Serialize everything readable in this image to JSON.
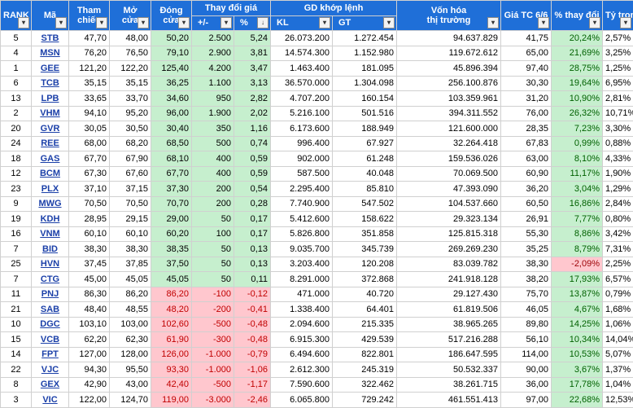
{
  "headers": {
    "rank": "RANK",
    "ma": "Mã",
    "tham_chieu": [
      "Tham",
      "chiếu"
    ],
    "mo_cua": [
      "Mở",
      "cửa"
    ],
    "dong_cua": [
      "Đóng",
      "cửa"
    ],
    "thay_doi": "Thay đổi giá",
    "thay_doi_abs": "+/-",
    "thay_doi_pct": "%",
    "gd": "GD khớp lệnh",
    "kl": "KL",
    "gt": "GT",
    "von_hoa": [
      "Vốn hóa",
      "thị trường"
    ],
    "gia_tc": "Giá TC 6/6",
    "pct_thay_doi": "% thay đổi",
    "ty_trong": "Tỷ trọng"
  },
  "filter_icon": "▾",
  "sort_icon": "↓",
  "colors": {
    "header_bg": "#1f6fd8",
    "green_fill": "#c6efce",
    "red_fill": "#ffc7ce",
    "neg_text": "#c00000"
  },
  "rows": [
    {
      "rank": "5",
      "ma": "STB",
      "tc": "47,70",
      "mo": "48,00",
      "dong": "50,20",
      "abs": "2.500",
      "pct": "5,24",
      "kl": "26.073.200",
      "gt": "1.272.454",
      "vh": "94.637.829",
      "gia": "41,75",
      "pct2": "20,24%",
      "tt": "2,57%",
      "dir": "up",
      "pct2sign": "pos"
    },
    {
      "rank": "4",
      "ma": "MSN",
      "tc": "76,20",
      "mo": "76,50",
      "dong": "79,10",
      "abs": "2.900",
      "pct": "3,81",
      "kl": "14.574.300",
      "gt": "1.152.980",
      "vh": "119.672.612",
      "gia": "65,00",
      "pct2": "21,69%",
      "tt": "3,25%",
      "dir": "up",
      "pct2sign": "pos"
    },
    {
      "rank": "1",
      "ma": "GEE",
      "tc": "121,20",
      "mo": "122,20",
      "dong": "125,40",
      "abs": "4.200",
      "pct": "3,47",
      "kl": "1.463.400",
      "gt": "181.095",
      "vh": "45.896.394",
      "gia": "97,40",
      "pct2": "28,75%",
      "tt": "1,25%",
      "dir": "up",
      "pct2sign": "pos"
    },
    {
      "rank": "6",
      "ma": "TCB",
      "tc": "35,15",
      "mo": "35,15",
      "dong": "36,25",
      "abs": "1.100",
      "pct": "3,13",
      "kl": "36.570.000",
      "gt": "1.304.098",
      "vh": "256.100.876",
      "gia": "30,30",
      "pct2": "19,64%",
      "tt": "6,95%",
      "dir": "up",
      "pct2sign": "pos"
    },
    {
      "rank": "13",
      "ma": "LPB",
      "tc": "33,65",
      "mo": "33,70",
      "dong": "34,60",
      "abs": "950",
      "pct": "2,82",
      "kl": "4.707.200",
      "gt": "160.154",
      "vh": "103.359.961",
      "gia": "31,20",
      "pct2": "10,90%",
      "tt": "2,81%",
      "dir": "up",
      "pct2sign": "pos"
    },
    {
      "rank": "2",
      "ma": "VHM",
      "tc": "94,10",
      "mo": "95,20",
      "dong": "96,00",
      "abs": "1.900",
      "pct": "2,02",
      "kl": "5.216.100",
      "gt": "501.516",
      "vh": "394.311.552",
      "gia": "76,00",
      "pct2": "26,32%",
      "tt": "10,71%",
      "dir": "up",
      "pct2sign": "pos"
    },
    {
      "rank": "20",
      "ma": "GVR",
      "tc": "30,05",
      "mo": "30,50",
      "dong": "30,40",
      "abs": "350",
      "pct": "1,16",
      "kl": "6.173.600",
      "gt": "188.949",
      "vh": "121.600.000",
      "gia": "28,35",
      "pct2": "7,23%",
      "tt": "3,30%",
      "dir": "up",
      "pct2sign": "pos"
    },
    {
      "rank": "24",
      "ma": "REE",
      "tc": "68,00",
      "mo": "68,20",
      "dong": "68,50",
      "abs": "500",
      "pct": "0,74",
      "kl": "996.400",
      "gt": "67.927",
      "vh": "32.264.418",
      "gia": "67,83",
      "pct2": "0,99%",
      "tt": "0,88%",
      "dir": "up",
      "pct2sign": "pos"
    },
    {
      "rank": "18",
      "ma": "GAS",
      "tc": "67,70",
      "mo": "67,90",
      "dong": "68,10",
      "abs": "400",
      "pct": "0,59",
      "kl": "902.000",
      "gt": "61.248",
      "vh": "159.536.026",
      "gia": "63,00",
      "pct2": "8,10%",
      "tt": "4,33%",
      "dir": "up",
      "pct2sign": "pos"
    },
    {
      "rank": "12",
      "ma": "BCM",
      "tc": "67,30",
      "mo": "67,60",
      "dong": "67,70",
      "abs": "400",
      "pct": "0,59",
      "kl": "587.500",
      "gt": "40.048",
      "vh": "70.069.500",
      "gia": "60,90",
      "pct2": "11,17%",
      "tt": "1,90%",
      "dir": "up",
      "pct2sign": "pos"
    },
    {
      "rank": "23",
      "ma": "PLX",
      "tc": "37,10",
      "mo": "37,15",
      "dong": "37,30",
      "abs": "200",
      "pct": "0,54",
      "kl": "2.295.400",
      "gt": "85.810",
      "vh": "47.393.090",
      "gia": "36,20",
      "pct2": "3,04%",
      "tt": "1,29%",
      "dir": "up",
      "pct2sign": "pos"
    },
    {
      "rank": "9",
      "ma": "MWG",
      "tc": "70,50",
      "mo": "70,50",
      "dong": "70,70",
      "abs": "200",
      "pct": "0,28",
      "kl": "7.740.900",
      "gt": "547.502",
      "vh": "104.537.660",
      "gia": "60,50",
      "pct2": "16,86%",
      "tt": "2,84%",
      "dir": "up",
      "pct2sign": "pos"
    },
    {
      "rank": "19",
      "ma": "KDH",
      "tc": "28,95",
      "mo": "29,15",
      "dong": "29,00",
      "abs": "50",
      "pct": "0,17",
      "kl": "5.412.600",
      "gt": "158.622",
      "vh": "29.323.134",
      "gia": "26,91",
      "pct2": "7,77%",
      "tt": "0,80%",
      "dir": "up",
      "pct2sign": "pos"
    },
    {
      "rank": "16",
      "ma": "VNM",
      "tc": "60,10",
      "mo": "60,10",
      "dong": "60,20",
      "abs": "100",
      "pct": "0,17",
      "kl": "5.826.800",
      "gt": "351.858",
      "vh": "125.815.318",
      "gia": "55,30",
      "pct2": "8,86%",
      "tt": "3,42%",
      "dir": "up",
      "pct2sign": "pos"
    },
    {
      "rank": "7",
      "ma": "BID",
      "tc": "38,30",
      "mo": "38,30",
      "dong": "38,35",
      "abs": "50",
      "pct": "0,13",
      "kl": "9.035.700",
      "gt": "345.739",
      "vh": "269.269.230",
      "gia": "35,25",
      "pct2": "8,79%",
      "tt": "7,31%",
      "dir": "up",
      "pct2sign": "pos"
    },
    {
      "rank": "25",
      "ma": "HVN",
      "tc": "37,45",
      "mo": "37,85",
      "dong": "37,50",
      "abs": "50",
      "pct": "0,13",
      "kl": "3.203.400",
      "gt": "120.208",
      "vh": "83.039.782",
      "gia": "38,30",
      "pct2": "-2,09%",
      "tt": "2,25%",
      "dir": "up",
      "pct2sign": "neg"
    },
    {
      "rank": "7",
      "ma": "CTG",
      "tc": "45,00",
      "mo": "45,05",
      "dong": "45,05",
      "abs": "50",
      "pct": "0,11",
      "kl": "8.291.000",
      "gt": "372.868",
      "vh": "241.918.128",
      "gia": "38,20",
      "pct2": "17,93%",
      "tt": "6,57%",
      "dir": "up",
      "pct2sign": "pos"
    },
    {
      "rank": "11",
      "ma": "PNJ",
      "tc": "86,30",
      "mo": "86,20",
      "dong": "86,20",
      "abs": "-100",
      "pct": "-0,12",
      "kl": "471.000",
      "gt": "40.720",
      "vh": "29.127.430",
      "gia": "75,70",
      "pct2": "13,87%",
      "tt": "0,79%",
      "dir": "down",
      "pct2sign": "pos"
    },
    {
      "rank": "21",
      "ma": "SAB",
      "tc": "48,40",
      "mo": "48,55",
      "dong": "48,20",
      "abs": "-200",
      "pct": "-0,41",
      "kl": "1.338.400",
      "gt": "64.401",
      "vh": "61.819.506",
      "gia": "46,05",
      "pct2": "4,67%",
      "tt": "1,68%",
      "dir": "down",
      "pct2sign": "pos"
    },
    {
      "rank": "10",
      "ma": "DGC",
      "tc": "103,10",
      "mo": "103,00",
      "dong": "102,60",
      "abs": "-500",
      "pct": "-0,48",
      "kl": "2.094.600",
      "gt": "215.335",
      "vh": "38.965.265",
      "gia": "89,80",
      "pct2": "14,25%",
      "tt": "1,06%",
      "dir": "down",
      "pct2sign": "pos"
    },
    {
      "rank": "15",
      "ma": "VCB",
      "tc": "62,20",
      "mo": "62,30",
      "dong": "61,90",
      "abs": "-300",
      "pct": "-0,48",
      "kl": "6.915.300",
      "gt": "429.539",
      "vh": "517.216.288",
      "gia": "56,10",
      "pct2": "10,34%",
      "tt": "14,04%",
      "dir": "down",
      "pct2sign": "pos"
    },
    {
      "rank": "14",
      "ma": "FPT",
      "tc": "127,00",
      "mo": "128,00",
      "dong": "126,00",
      "abs": "-1.000",
      "pct": "-0,79",
      "kl": "6.494.600",
      "gt": "822.801",
      "vh": "186.647.595",
      "gia": "114,00",
      "pct2": "10,53%",
      "tt": "5,07%",
      "dir": "down",
      "pct2sign": "pos"
    },
    {
      "rank": "22",
      "ma": "VJC",
      "tc": "94,30",
      "mo": "95,50",
      "dong": "93,30",
      "abs": "-1.000",
      "pct": "-1,06",
      "kl": "2.612.300",
      "gt": "245.319",
      "vh": "50.532.337",
      "gia": "90,00",
      "pct2": "3,67%",
      "tt": "1,37%",
      "dir": "down",
      "pct2sign": "pos"
    },
    {
      "rank": "8",
      "ma": "GEX",
      "tc": "42,90",
      "mo": "43,00",
      "dong": "42,40",
      "abs": "-500",
      "pct": "-1,17",
      "kl": "7.590.600",
      "gt": "322.462",
      "vh": "38.261.715",
      "gia": "36,00",
      "pct2": "17,78%",
      "tt": "1,04%",
      "dir": "down",
      "pct2sign": "pos"
    },
    {
      "rank": "3",
      "ma": "VIC",
      "tc": "122,00",
      "mo": "124,70",
      "dong": "119,00",
      "abs": "-3.000",
      "pct": "-2,46",
      "kl": "6.065.800",
      "gt": "729.242",
      "vh": "461.551.413",
      "gia": "97,00",
      "pct2": "22,68%",
      "tt": "12,53%",
      "dir": "down",
      "pct2sign": "pos"
    }
  ]
}
